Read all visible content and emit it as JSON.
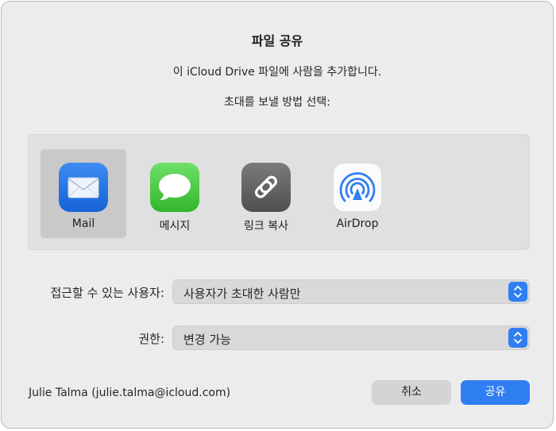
{
  "dialog": {
    "title": "파일 공유",
    "subtitle": "이 iCloud Drive 파일에 사람을 추가합니다.",
    "method_label": "초대를 보낼 방법 선택:"
  },
  "methods": [
    {
      "label": "Mail",
      "icon": "mail-icon",
      "selected": true
    },
    {
      "label": "메시지",
      "icon": "messages-icon",
      "selected": false
    },
    {
      "label": "링크 복사",
      "icon": "link-icon",
      "selected": false
    },
    {
      "label": "AirDrop",
      "icon": "airdrop-icon",
      "selected": false
    }
  ],
  "access": {
    "label": "접근할 수 있는 사용자:",
    "value": "사용자가 초대한 사람만"
  },
  "permission": {
    "label": "권한:",
    "value": "변경 가능"
  },
  "footer": {
    "user": "Julie Talma (julie.talma@icloud.com)",
    "cancel_label": "취소",
    "share_label": "공유"
  },
  "colors": {
    "accent": "#2f7ff3",
    "dialog_bg": "#ececec",
    "selected_bg": "#c9c9c9"
  }
}
